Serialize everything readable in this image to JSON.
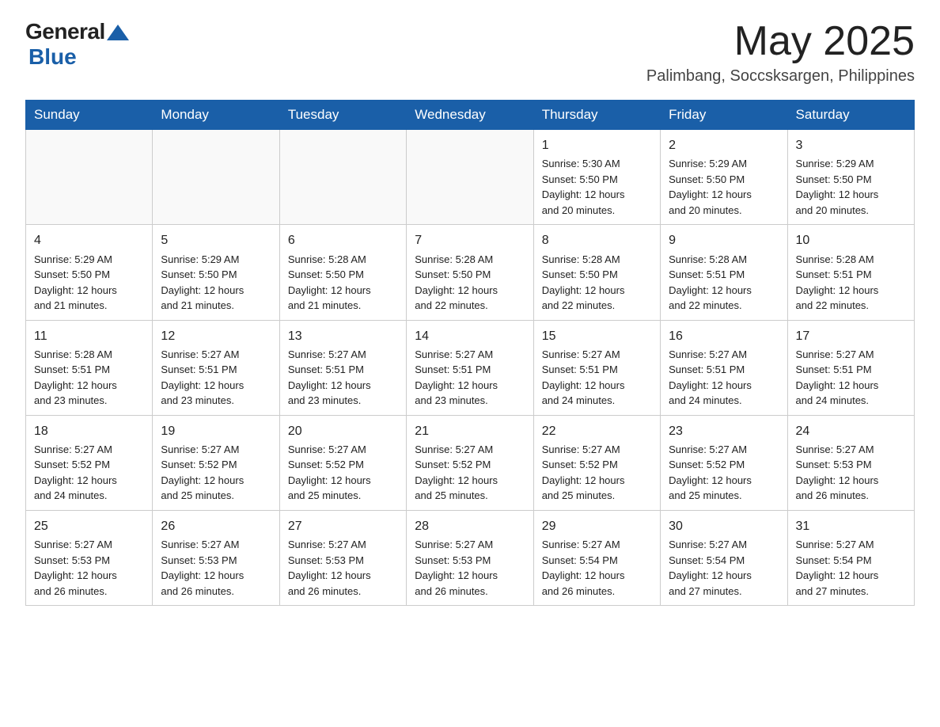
{
  "header": {
    "logo_general": "General",
    "logo_blue": "Blue",
    "month_title": "May 2025",
    "location": "Palimbang, Soccsksargen, Philippines"
  },
  "weekdays": [
    "Sunday",
    "Monday",
    "Tuesday",
    "Wednesday",
    "Thursday",
    "Friday",
    "Saturday"
  ],
  "weeks": [
    [
      {
        "day": "",
        "info": ""
      },
      {
        "day": "",
        "info": ""
      },
      {
        "day": "",
        "info": ""
      },
      {
        "day": "",
        "info": ""
      },
      {
        "day": "1",
        "info": "Sunrise: 5:30 AM\nSunset: 5:50 PM\nDaylight: 12 hours\nand 20 minutes."
      },
      {
        "day": "2",
        "info": "Sunrise: 5:29 AM\nSunset: 5:50 PM\nDaylight: 12 hours\nand 20 minutes."
      },
      {
        "day": "3",
        "info": "Sunrise: 5:29 AM\nSunset: 5:50 PM\nDaylight: 12 hours\nand 20 minutes."
      }
    ],
    [
      {
        "day": "4",
        "info": "Sunrise: 5:29 AM\nSunset: 5:50 PM\nDaylight: 12 hours\nand 21 minutes."
      },
      {
        "day": "5",
        "info": "Sunrise: 5:29 AM\nSunset: 5:50 PM\nDaylight: 12 hours\nand 21 minutes."
      },
      {
        "day": "6",
        "info": "Sunrise: 5:28 AM\nSunset: 5:50 PM\nDaylight: 12 hours\nand 21 minutes."
      },
      {
        "day": "7",
        "info": "Sunrise: 5:28 AM\nSunset: 5:50 PM\nDaylight: 12 hours\nand 22 minutes."
      },
      {
        "day": "8",
        "info": "Sunrise: 5:28 AM\nSunset: 5:50 PM\nDaylight: 12 hours\nand 22 minutes."
      },
      {
        "day": "9",
        "info": "Sunrise: 5:28 AM\nSunset: 5:51 PM\nDaylight: 12 hours\nand 22 minutes."
      },
      {
        "day": "10",
        "info": "Sunrise: 5:28 AM\nSunset: 5:51 PM\nDaylight: 12 hours\nand 22 minutes."
      }
    ],
    [
      {
        "day": "11",
        "info": "Sunrise: 5:28 AM\nSunset: 5:51 PM\nDaylight: 12 hours\nand 23 minutes."
      },
      {
        "day": "12",
        "info": "Sunrise: 5:27 AM\nSunset: 5:51 PM\nDaylight: 12 hours\nand 23 minutes."
      },
      {
        "day": "13",
        "info": "Sunrise: 5:27 AM\nSunset: 5:51 PM\nDaylight: 12 hours\nand 23 minutes."
      },
      {
        "day": "14",
        "info": "Sunrise: 5:27 AM\nSunset: 5:51 PM\nDaylight: 12 hours\nand 23 minutes."
      },
      {
        "day": "15",
        "info": "Sunrise: 5:27 AM\nSunset: 5:51 PM\nDaylight: 12 hours\nand 24 minutes."
      },
      {
        "day": "16",
        "info": "Sunrise: 5:27 AM\nSunset: 5:51 PM\nDaylight: 12 hours\nand 24 minutes."
      },
      {
        "day": "17",
        "info": "Sunrise: 5:27 AM\nSunset: 5:51 PM\nDaylight: 12 hours\nand 24 minutes."
      }
    ],
    [
      {
        "day": "18",
        "info": "Sunrise: 5:27 AM\nSunset: 5:52 PM\nDaylight: 12 hours\nand 24 minutes."
      },
      {
        "day": "19",
        "info": "Sunrise: 5:27 AM\nSunset: 5:52 PM\nDaylight: 12 hours\nand 25 minutes."
      },
      {
        "day": "20",
        "info": "Sunrise: 5:27 AM\nSunset: 5:52 PM\nDaylight: 12 hours\nand 25 minutes."
      },
      {
        "day": "21",
        "info": "Sunrise: 5:27 AM\nSunset: 5:52 PM\nDaylight: 12 hours\nand 25 minutes."
      },
      {
        "day": "22",
        "info": "Sunrise: 5:27 AM\nSunset: 5:52 PM\nDaylight: 12 hours\nand 25 minutes."
      },
      {
        "day": "23",
        "info": "Sunrise: 5:27 AM\nSunset: 5:52 PM\nDaylight: 12 hours\nand 25 minutes."
      },
      {
        "day": "24",
        "info": "Sunrise: 5:27 AM\nSunset: 5:53 PM\nDaylight: 12 hours\nand 26 minutes."
      }
    ],
    [
      {
        "day": "25",
        "info": "Sunrise: 5:27 AM\nSunset: 5:53 PM\nDaylight: 12 hours\nand 26 minutes."
      },
      {
        "day": "26",
        "info": "Sunrise: 5:27 AM\nSunset: 5:53 PM\nDaylight: 12 hours\nand 26 minutes."
      },
      {
        "day": "27",
        "info": "Sunrise: 5:27 AM\nSunset: 5:53 PM\nDaylight: 12 hours\nand 26 minutes."
      },
      {
        "day": "28",
        "info": "Sunrise: 5:27 AM\nSunset: 5:53 PM\nDaylight: 12 hours\nand 26 minutes."
      },
      {
        "day": "29",
        "info": "Sunrise: 5:27 AM\nSunset: 5:54 PM\nDaylight: 12 hours\nand 26 minutes."
      },
      {
        "day": "30",
        "info": "Sunrise: 5:27 AM\nSunset: 5:54 PM\nDaylight: 12 hours\nand 27 minutes."
      },
      {
        "day": "31",
        "info": "Sunrise: 5:27 AM\nSunset: 5:54 PM\nDaylight: 12 hours\nand 27 minutes."
      }
    ]
  ]
}
